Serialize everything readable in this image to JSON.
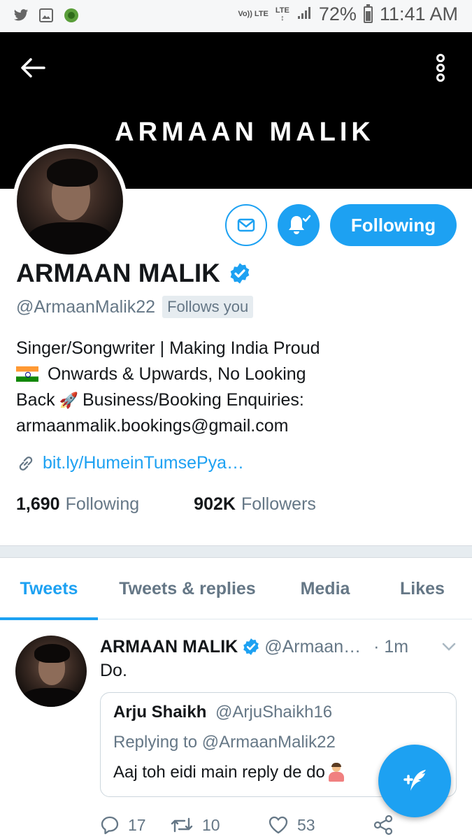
{
  "status_bar": {
    "network_top": "Vo)) LTE",
    "network_bottom": "LTE",
    "battery_percent": "72%",
    "time": "11:41 AM"
  },
  "banner": {
    "title": "ARMAAN MALIK"
  },
  "profile": {
    "name": "ARMAAN MALIK",
    "verified": true,
    "handle": "@ArmaanMalik22",
    "follows_you": "Follows you",
    "bio_line1": "Singer/Songwriter | Making India Proud",
    "bio_line2": " Onwards & Upwards, No Looking",
    "bio_line3_a": "Back",
    "bio_line3_b": "Business/Booking Enquiries:",
    "bio_line4": "armaanmalik.bookings@gmail.com",
    "link": "bit.ly/HumeinTumsePya…",
    "following_count": "1,690",
    "following_label": "Following",
    "followers_count": "902K",
    "followers_label": "Followers"
  },
  "actions": {
    "following_button": "Following"
  },
  "tabs": [
    {
      "label": "Tweets",
      "active": true
    },
    {
      "label": "Tweets & replies",
      "active": false
    },
    {
      "label": "Media",
      "active": false
    },
    {
      "label": "Likes",
      "active": false
    }
  ],
  "tweet": {
    "name": "ARMAAN MALIK",
    "handle": "@Armaan…",
    "time": "· 1m",
    "text": "Do.",
    "quote": {
      "name": "Arju Shaikh",
      "handle": "@ArjuShaikh16",
      "replying_to": "Replying to @ArmaanMalik22",
      "text": "Aaj toh eidi main reply de do"
    },
    "reply_count": "17",
    "retweet_count": "10",
    "like_count": "53"
  },
  "colors": {
    "accent": "#1da1f2",
    "text_primary": "#14171a",
    "text_secondary": "#657786",
    "banner_bg": "#000000"
  },
  "icons": {
    "status_left": [
      "twitter-bird-icon",
      "gallery-icon",
      "app-icon"
    ],
    "header": [
      "back-arrow-icon",
      "more-vertical-icon"
    ],
    "profile": [
      "mail-icon",
      "bell-check-icon",
      "verified-badge-icon",
      "link-icon"
    ],
    "tweet": [
      "chevron-down-icon",
      "reply-icon",
      "retweet-icon",
      "heart-icon",
      "share-icon"
    ],
    "fab": "compose-quill-icon"
  }
}
